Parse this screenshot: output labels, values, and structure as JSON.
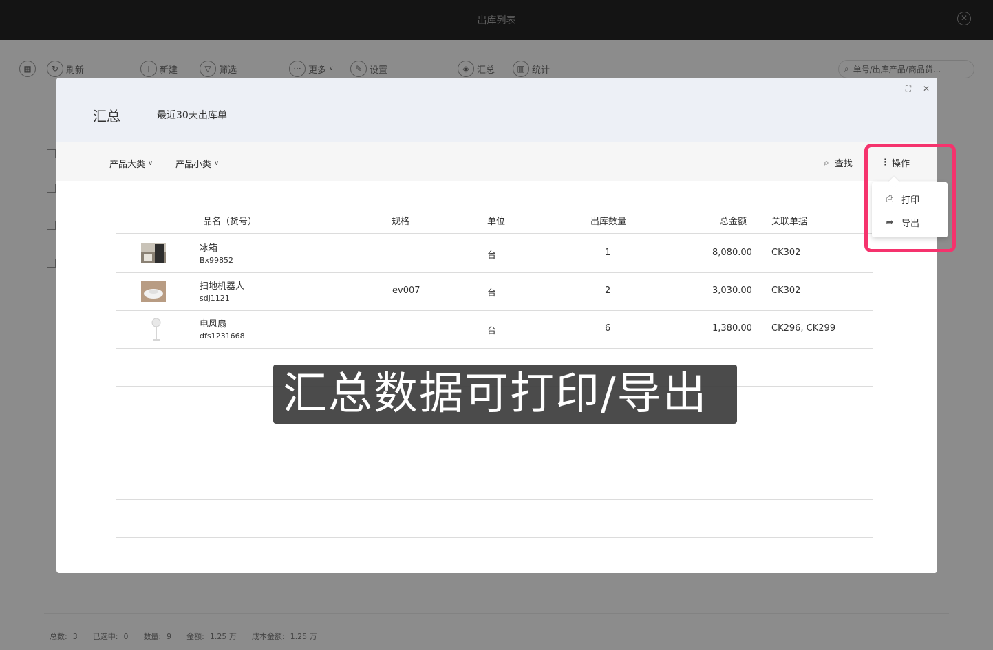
{
  "window": {
    "title": "出库列表",
    "close_icon": "close-circle-icon"
  },
  "toolbar": {
    "items": [
      {
        "label": "",
        "icon": "grid-icon"
      },
      {
        "label": "刷新",
        "icon": "refresh-icon"
      },
      {
        "label": "新建",
        "icon": "plus-icon"
      },
      {
        "label": "筛选",
        "icon": "filter-icon"
      },
      {
        "label": "更多",
        "icon": "more-icon"
      },
      {
        "label": "设置",
        "icon": "wrench-icon"
      },
      {
        "label": "汇总",
        "icon": "layers-icon"
      },
      {
        "label": "统计",
        "icon": "bar-chart-icon"
      }
    ],
    "search_placeholder": "单号/出库产品/商品货..."
  },
  "footer": {
    "total_label": "总数:",
    "total_value": "3",
    "selected_label": "已选中:",
    "selected_value": "0",
    "qty_label": "数量:",
    "qty_value": "9",
    "amount_label": "金额:",
    "amount_value": "1.25 万",
    "cost_label": "成本金额:",
    "cost_value": "1.25 万"
  },
  "modal": {
    "title": "汇总",
    "subtitle": "最近30天出库单",
    "filters": [
      {
        "label": "产品大类"
      },
      {
        "label": "产品小类"
      }
    ],
    "find_label": "查找",
    "ops_label": "操作",
    "menu": [
      {
        "label": "打印",
        "icon": "printer-icon"
      },
      {
        "label": "导出",
        "icon": "share-arrow-icon"
      }
    ],
    "table": {
      "headers": [
        "品名（货号）",
        "规格",
        "单位",
        "出库数量",
        "总金额",
        "关联单据"
      ],
      "rows": [
        {
          "name": "冰箱",
          "code": "Bx99852",
          "spec": "",
          "unit": "台",
          "qty": "1",
          "amount": "8,080.00",
          "ref": "CK302"
        },
        {
          "name": "扫地机器人",
          "code": "sdj1121",
          "spec": "ev007",
          "unit": "台",
          "qty": "2",
          "amount": "3,030.00",
          "ref": "CK302"
        },
        {
          "name": "电风扇",
          "code": "dfs1231668",
          "spec": "",
          "unit": "台",
          "qty": "6",
          "amount": "1,380.00",
          "ref": "CK296, CK299"
        }
      ]
    }
  },
  "caption": "汇总数据可打印/导出",
  "colors": {
    "highlight": "#f5336d",
    "header_bg": "#edf0f6",
    "filter_bg": "#f6f6f6"
  }
}
